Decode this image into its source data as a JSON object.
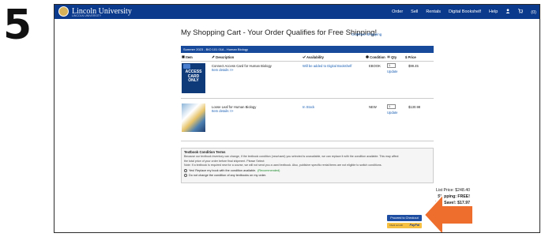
{
  "step_number": "5",
  "nav": {
    "brand": "Lincoln University",
    "brand_sub": "LINCOLN UNIVERSITY",
    "links": [
      "Order",
      "Sell",
      "Rentals",
      "Digital Bookshelf",
      "Help"
    ],
    "cart_count": "(0)"
  },
  "page": {
    "title": "My Shopping Cart - Your Order Qualifies for Free Shipping!",
    "continue_link": "Continue Shopping"
  },
  "course": "Summer 2023 - BIO 101 01A - Human Biology",
  "table_headers": {
    "item": "Item",
    "description": "Description",
    "availability": "Availability",
    "condition": "Condition",
    "qty": "Qty",
    "price": "Price"
  },
  "items": [
    {
      "cover_text": [
        "ACCESS",
        "CARD",
        "ONLY"
      ],
      "title": "Connect Access Card for Human Biology",
      "details_link": "Item details >>",
      "availability": "Will be added to Digital Bookshelf",
      "condition": "EBOOK",
      "qty": "1",
      "update": "Update",
      "price": "$99.45"
    },
    {
      "cover_text": [],
      "title": "Loose Leaf for Human Biology",
      "details_link": "Item details >>",
      "availability": "In Stock",
      "condition": "NEW",
      "qty": "1",
      "update": "Update",
      "price": "$130.98"
    }
  ],
  "terms": {
    "title": "Textbook Condition Terms",
    "line1": "Because our textbook inventory can change, if the textbook condition (new/used) you selected is unavailable, we can replace it with the condition available. This may affect",
    "line2": "the total price of your order before final shipment. Please Select:",
    "note": "Note: If a textbook is required new for a course, we will not send you a used textbook. Also, publisher specific rental items are not eligible to switch conditions.",
    "option1": "Yes! Replace my book with the condition available.",
    "option1_rec": "(Recommended)",
    "option2": "Do not change the condition of any textbooks on my order."
  },
  "totals": {
    "list_price": "List Price: $248.40",
    "shipping": "Shipping: FREE!",
    "you_save": "You Save!: $17.97",
    "subtotal": "Subtotal: $230.43"
  },
  "buttons": {
    "checkout": "Proceed to Checkout",
    "paypal_prefix": "Check out with",
    "paypal_logo": "PayPal"
  },
  "colors": {
    "nav": "#0b3a8c",
    "accent_arrow": "#ee6f2d",
    "link": "#1a5fb4"
  }
}
